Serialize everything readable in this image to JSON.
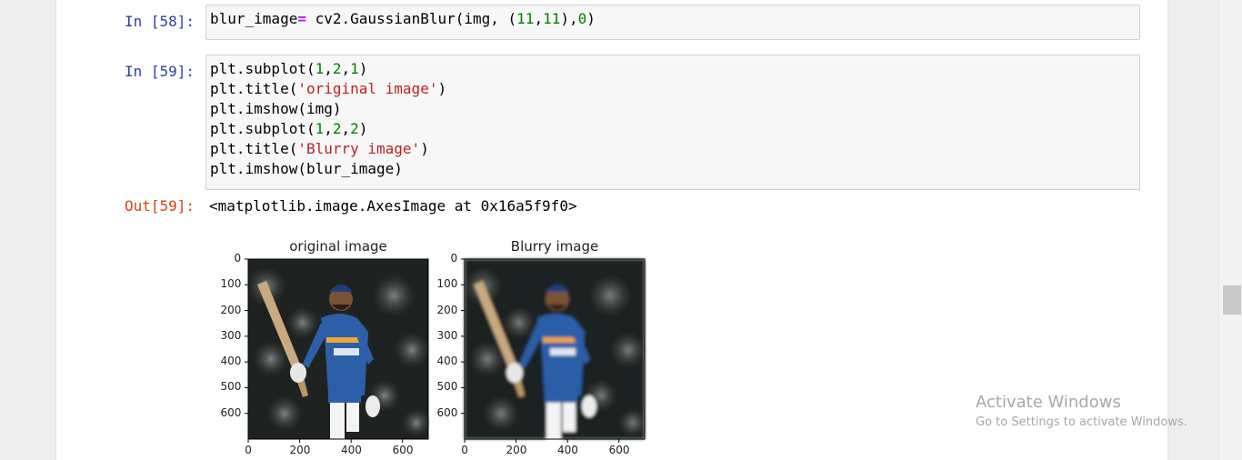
{
  "cells": [
    {
      "prompt": "In [58]:"
    },
    {
      "prompt": "In [59]:"
    }
  ],
  "output": {
    "prompt": "Out[59]:",
    "text": "<matplotlib.image.AxesImage at 0x16a5f9f0>"
  },
  "figure": {
    "left_title": "original image",
    "right_title": "Blurry image",
    "y_ticks": [
      "0",
      "100",
      "200",
      "300",
      "400",
      "500",
      "600"
    ],
    "x_ticks": [
      "0",
      "200",
      "400",
      "600"
    ],
    "image_content": "cricketer-in-blue-jersey-holding-bat"
  },
  "watermark": {
    "title": "Activate Windows",
    "subtitle": "Go to Settings to activate Windows."
  },
  "colors": {
    "in_prompt": "#303f9f",
    "out_prompt": "#d84315",
    "keyword_op": "#aa22ff",
    "string": "#ba2121",
    "number": "#008000"
  }
}
